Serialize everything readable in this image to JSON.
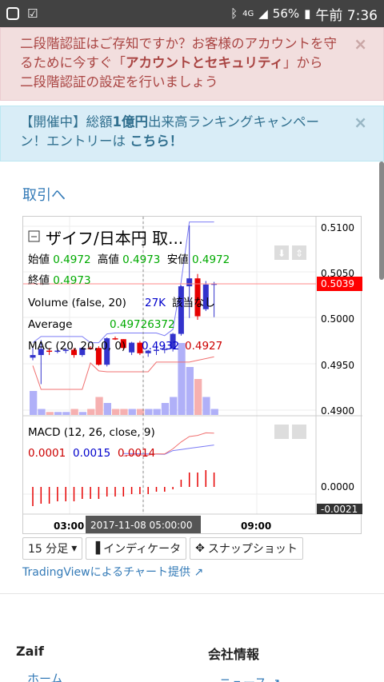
{
  "status_bar": {
    "network": "4G",
    "battery": "56%",
    "time": "午前 7:36"
  },
  "alert_danger": {
    "line1": "二段階認証はご存知ですか？お客様のアカウントを守",
    "line2a": "るために今すぐ「",
    "line2_bold": "アカウントとセキュリティ",
    "line2b": "」から",
    "line3": "二段階認証の設定を行いましょう",
    "close": "×"
  },
  "alert_info": {
    "line1a": "【開催中】総額",
    "line1_bold": "1億円",
    "line1b": "出来高ランキングキャンペー",
    "line2a": "ン！エントリーは ",
    "line2_link": "こちら！",
    "close": "×"
  },
  "back_link": "取引へ",
  "chart": {
    "title": "ザイフ/日本円 取...",
    "ohlc": {
      "open_label": "始値",
      "open": "0.4972",
      "high_label": "高値",
      "high": "0.4973",
      "low_label": "安値",
      "low": "0.4972",
      "close_label": "終値",
      "close": "0.4973"
    },
    "volume_label": "Volume (false, 20)",
    "volume_value": "27K",
    "volume_na": "該当なし",
    "average_label": "Average",
    "average_value": "0.49726372",
    "mac_label": "MAC (20, 20, 0, 0)",
    "mac_value1": "0.4932",
    "mac_value2": "0.4927",
    "macd_label": "MACD (12, 26, close, 9)",
    "macd_values": [
      "0.0001",
      "0.0015",
      "0.0014"
    ],
    "price_axis": [
      "0.5100",
      "0.5050",
      "0.5000",
      "0.4950",
      "0.4900"
    ],
    "macd_axis": [
      "0.0000",
      "-0.0021"
    ],
    "last_price": "0.5039",
    "time_axis": [
      "03:00",
      "09:00"
    ],
    "crosshair_time": "2017-11-08 05:00:00",
    "colors": {
      "up": "#3333cc",
      "down": "#e60000",
      "mac_upper": "#7c7cf5",
      "mac_lower": "#f07070"
    }
  },
  "chart_data": {
    "type": "candlestick",
    "ylim": [
      0.489,
      0.5115
    ],
    "candles": [
      {
        "o": 0.4955,
        "h": 0.4968,
        "l": 0.4952,
        "c": 0.4958
      },
      {
        "o": 0.4958,
        "h": 0.4975,
        "l": 0.4925,
        "c": 0.4965
      },
      {
        "o": 0.4963,
        "h": 0.4966,
        "l": 0.4958,
        "c": 0.4962
      },
      {
        "o": 0.4962,
        "h": 0.4965,
        "l": 0.496,
        "c": 0.4963
      },
      {
        "o": 0.4963,
        "h": 0.4966,
        "l": 0.496,
        "c": 0.4964
      },
      {
        "o": 0.4964,
        "h": 0.4966,
        "l": 0.4955,
        "c": 0.4958
      },
      {
        "o": 0.4958,
        "h": 0.4967,
        "l": 0.4956,
        "c": 0.4966
      },
      {
        "o": 0.4966,
        "h": 0.4968,
        "l": 0.4964,
        "c": 0.4965
      },
      {
        "o": 0.4966,
        "h": 0.4968,
        "l": 0.4946,
        "c": 0.4947
      },
      {
        "o": 0.4947,
        "h": 0.4978,
        "l": 0.4945,
        "c": 0.4977
      },
      {
        "o": 0.4977,
        "h": 0.4979,
        "l": 0.4975,
        "c": 0.4976
      },
      {
        "o": 0.4976,
        "h": 0.4976,
        "l": 0.4964,
        "c": 0.4966
      },
      {
        "o": 0.4961,
        "h": 0.4973,
        "l": 0.4958,
        "c": 0.4972
      },
      {
        "o": 0.4972,
        "h": 0.4974,
        "l": 0.4958,
        "c": 0.496
      },
      {
        "o": 0.496,
        "h": 0.4964,
        "l": 0.4956,
        "c": 0.4963
      },
      {
        "o": 0.4963,
        "h": 0.4966,
        "l": 0.4958,
        "c": 0.4964
      },
      {
        "o": 0.4964,
        "h": 0.497,
        "l": 0.496,
        "c": 0.4965
      },
      {
        "o": 0.4965,
        "h": 0.4983,
        "l": 0.4962,
        "c": 0.4982
      },
      {
        "o": 0.4982,
        "h": 0.5037,
        "l": 0.498,
        "c": 0.5036
      },
      {
        "o": 0.5036,
        "h": 0.5105,
        "l": 0.5,
        "c": 0.5045
      },
      {
        "o": 0.5045,
        "h": 0.505,
        "l": 0.4998,
        "c": 0.5002
      },
      {
        "o": 0.501,
        "h": 0.5042,
        "l": 0.5008,
        "c": 0.5038
      },
      {
        "o": 0.5038,
        "h": 0.5041,
        "l": 0.5001,
        "c": 0.5039
      }
    ],
    "volume": [
      4,
      1,
      0.5,
      0.5,
      0.5,
      1,
      0.5,
      1,
      3,
      2,
      1,
      1,
      1,
      1,
      1,
      1,
      2,
      3,
      12,
      8,
      6,
      3,
      1
    ],
    "macd_hist": [
      -0.0008,
      -0.0007,
      -0.0007,
      -0.0006,
      -0.0006,
      -0.0006,
      -0.0005,
      -0.0005,
      -0.0005,
      -0.0004,
      -0.0004,
      -0.0004,
      -0.0003,
      -0.0003,
      -0.0003,
      -0.0002,
      -0.0002,
      -0.0001,
      0.0003,
      0.0006,
      0.0006,
      0.0007,
      0.0006
    ]
  },
  "toolbar": {
    "interval": "15 分足",
    "indicators": "インディケータ",
    "snapshot": "スナップショット"
  },
  "tv_credit": "TradingViewによるチャート提供",
  "footer": {
    "col1_title": "Zaif",
    "col1_link": "ホーム",
    "col2_title": "会社情報",
    "col2_link": "ニュース"
  }
}
